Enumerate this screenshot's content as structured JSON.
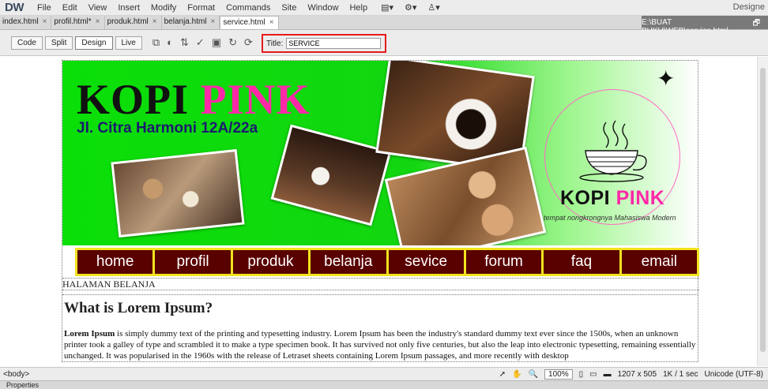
{
  "app": {
    "logo": "DW",
    "menu": [
      "File",
      "Edit",
      "View",
      "Insert",
      "Modify",
      "Format",
      "Commands",
      "Site",
      "Window",
      "Help"
    ],
    "workspace": "Designe"
  },
  "tabs": [
    {
      "label": "index.html"
    },
    {
      "label": "profil.html*"
    },
    {
      "label": "produk.html"
    },
    {
      "label": "belanja.html"
    },
    {
      "label": "service.html",
      "active": true
    }
  ],
  "file_path": "E:\\BUAT BUKU\\WEB\\service.html",
  "doc_toolbar": {
    "views": [
      "Code",
      "Split",
      "Design",
      "Live"
    ],
    "active_view": "Design",
    "title_label": "Title:",
    "title_value": "SERVICE"
  },
  "header": {
    "brand_black": "KOPI",
    "brand_pink": "PINK",
    "address": "Jl. Citra Harmoni 12A/22a",
    "logo_brand_black": "KOPI",
    "logo_brand_pink": "PINK",
    "tagline": "tempat nongkrongnya Mahasiswa Modern"
  },
  "nav": [
    "home",
    "profil",
    "produk",
    "belanja",
    "sevice",
    "forum",
    "faq",
    "email"
  ],
  "content": {
    "section_label": "HALAMAN BELANJA",
    "heading": "What is Lorem Ipsum?",
    "para_bold": "Lorem Ipsum",
    "para_text": " is simply dummy text of the printing and typesetting industry. Lorem Ipsum has been the industry's standard dummy text ever since the 1500s, when an unknown printer took a galley of type and scrambled it to make a type specimen book. It has survived not only five centuries, but also the leap into electronic typesetting, remaining essentially unchanged. It was popularised in the 1960s with the release of Letraset sheets containing Lorem Ipsum passages, and more recently with desktop"
  },
  "status": {
    "tag": "<body>",
    "zoom": "100%",
    "dimensions": "1207 x 505",
    "download": "1K / 1 sec",
    "encoding": "Unicode (UTF-8)"
  },
  "properties_label": "Properties",
  "colors": {
    "brand_pink": "#ff29a8",
    "nav_bg": "#590000",
    "nav_border": "#f2e21e",
    "header_green": "#0adf08",
    "title_highlight": "#e41b1b"
  }
}
